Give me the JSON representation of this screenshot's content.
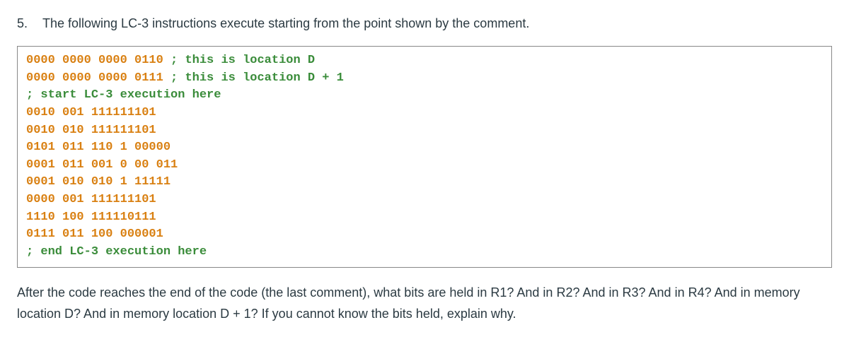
{
  "question": {
    "number": "5.",
    "text": "The following LC-3 instructions execute starting from the point shown by the comment."
  },
  "code": {
    "lines": [
      {
        "binary": "0000 0000 0000 0110 ",
        "comment": "; this is location D"
      },
      {
        "binary": "0000 0000 0000 0111 ",
        "comment": "; this is location D + 1"
      },
      {
        "binary": "",
        "comment": "; start LC-3 execution here"
      },
      {
        "binary": "0010 001 111111101",
        "comment": ""
      },
      {
        "binary": "0010 010 111111101",
        "comment": ""
      },
      {
        "binary": "0101 011 110 1 00000",
        "comment": ""
      },
      {
        "binary": "0001 011 001 0 00 011",
        "comment": ""
      },
      {
        "binary": "0001 010 010 1 11111",
        "comment": ""
      },
      {
        "binary": "0000 001 111111101",
        "comment": ""
      },
      {
        "binary": "1110 100 111110111",
        "comment": ""
      },
      {
        "binary": "0111 011 100 000001",
        "comment": ""
      },
      {
        "binary": "",
        "comment": "; end LC-3 execution here"
      }
    ]
  },
  "follow_up": "After the code reaches the end of the code (the last comment), what bits are held in R1?  And in R2?  And in R3?  And in R4?  And in memory location D?  And in memory location D + 1? If you cannot know the bits held, explain why."
}
